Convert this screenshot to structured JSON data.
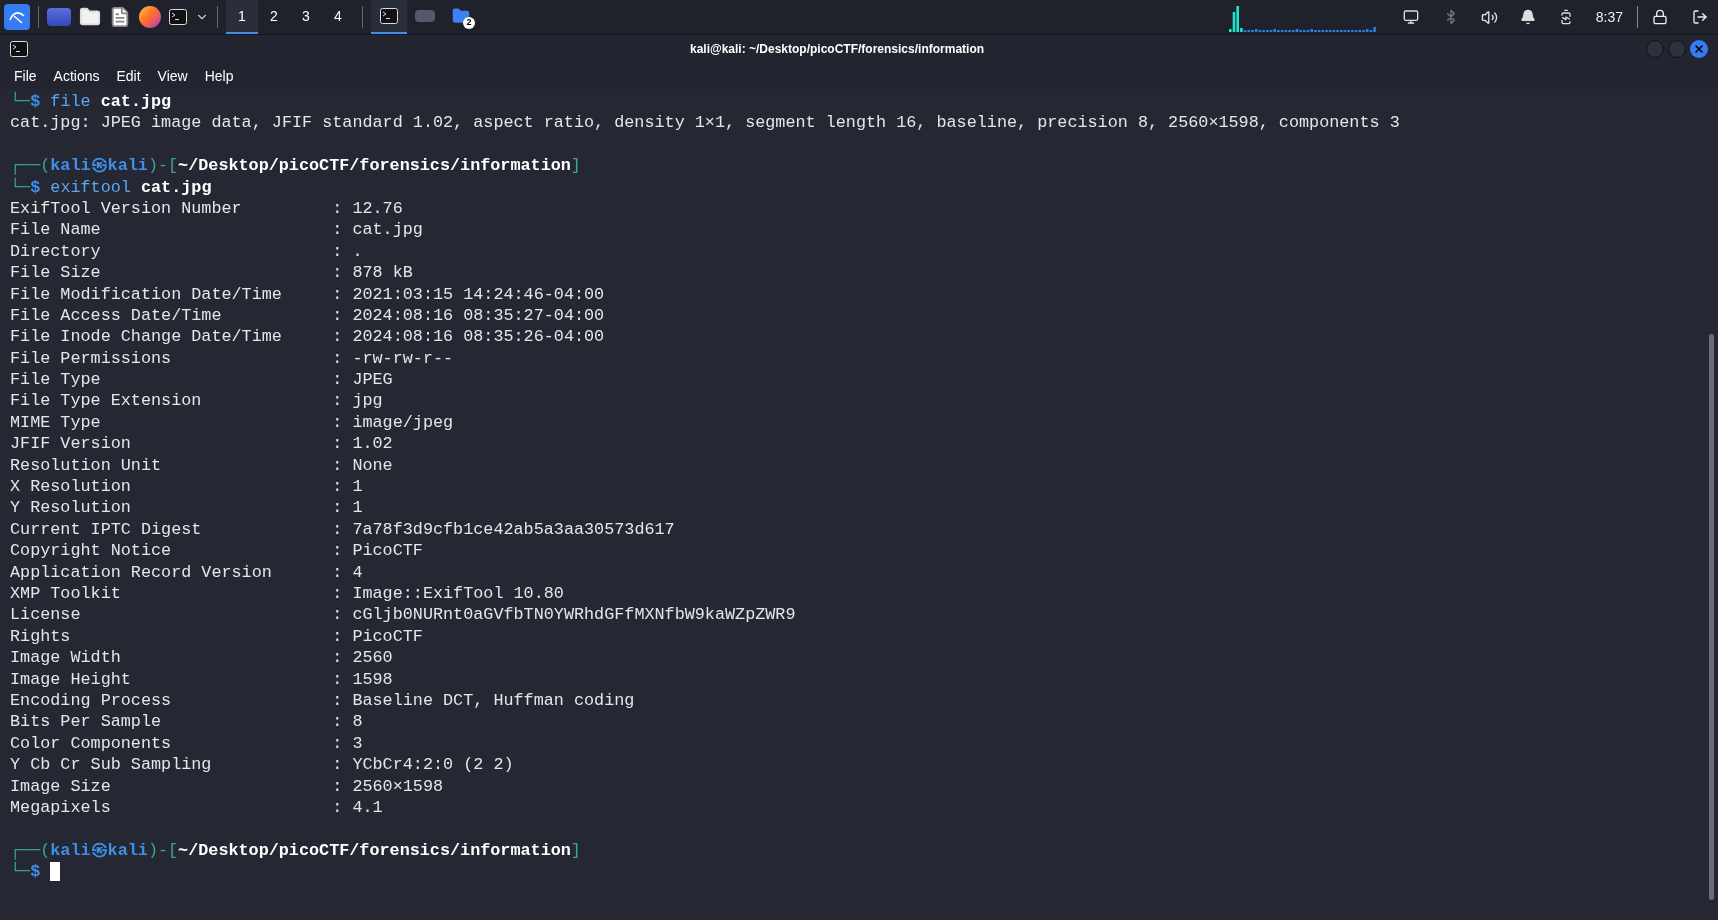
{
  "taskbar": {
    "workspaces": [
      {
        "label": "1",
        "selected": true
      },
      {
        "label": "2",
        "selected": false
      },
      {
        "label": "3",
        "selected": false
      },
      {
        "label": "4",
        "selected": false
      }
    ],
    "tasks": [
      {
        "kind": "terminal",
        "selected": true
      },
      {
        "kind": "image",
        "selected": false
      },
      {
        "kind": "folder",
        "selected": false,
        "badge": "2"
      }
    ],
    "clock": "8:37"
  },
  "window": {
    "title": "kali@kali: ~/Desktop/picoCTF/forensics/information",
    "menu": [
      "File",
      "Actions",
      "Edit",
      "View",
      "Help"
    ]
  },
  "terminal": {
    "field_separator": ":",
    "lines": [
      {
        "kind": "segments",
        "segments": [
          {
            "kind": "frame",
            "text": "└─"
          },
          {
            "kind": "prompt",
            "text": "$ "
          },
          {
            "kind": "command",
            "text": "file "
          },
          {
            "kind": "arg",
            "text": "cat.jpg"
          }
        ]
      },
      {
        "kind": "segments",
        "segments": [
          {
            "kind": "plain",
            "text": "cat.jpg: JPEG image data, JFIF standard 1.02, aspect ratio, density 1×1, segment length 16, baseline, precision 8, 2560×1598, components 3"
          }
        ]
      },
      {
        "kind": "blank"
      },
      {
        "kind": "segments",
        "segments": [
          {
            "kind": "frame",
            "text": "┌──("
          },
          {
            "kind": "user",
            "text": "kali㉿kali"
          },
          {
            "kind": "frame",
            "text": ")-["
          },
          {
            "kind": "path",
            "text": "~/Desktop/picoCTF/forensics/information"
          },
          {
            "kind": "frame",
            "text": "]"
          }
        ]
      },
      {
        "kind": "segments",
        "segments": [
          {
            "kind": "frame",
            "text": "└─"
          },
          {
            "kind": "prompt",
            "text": "$ "
          },
          {
            "kind": "command",
            "text": "exiftool "
          },
          {
            "kind": "arg",
            "text": "cat.jpg"
          }
        ]
      },
      {
        "kind": "field",
        "key": "ExifTool Version Number",
        "value": "12.76"
      },
      {
        "kind": "field",
        "key": "File Name",
        "value": "cat.jpg"
      },
      {
        "kind": "field",
        "key": "Directory",
        "value": "."
      },
      {
        "kind": "field",
        "key": "File Size",
        "value": "878 kB"
      },
      {
        "kind": "field",
        "key": "File Modification Date/Time",
        "value": "2021:03:15 14:24:46-04:00"
      },
      {
        "kind": "field",
        "key": "File Access Date/Time",
        "value": "2024:08:16 08:35:27-04:00"
      },
      {
        "kind": "field",
        "key": "File Inode Change Date/Time",
        "value": "2024:08:16 08:35:26-04:00"
      },
      {
        "kind": "field",
        "key": "File Permissions",
        "value": "-rw-rw-r--"
      },
      {
        "kind": "field",
        "key": "File Type",
        "value": "JPEG"
      },
      {
        "kind": "field",
        "key": "File Type Extension",
        "value": "jpg"
      },
      {
        "kind": "field",
        "key": "MIME Type",
        "value": "image/jpeg"
      },
      {
        "kind": "field",
        "key": "JFIF Version",
        "value": "1.02"
      },
      {
        "kind": "field",
        "key": "Resolution Unit",
        "value": "None"
      },
      {
        "kind": "field",
        "key": "X Resolution",
        "value": "1"
      },
      {
        "kind": "field",
        "key": "Y Resolution",
        "value": "1"
      },
      {
        "kind": "field",
        "key": "Current IPTC Digest",
        "value": "7a78f3d9cfb1ce42ab5a3aa30573d617"
      },
      {
        "kind": "field",
        "key": "Copyright Notice",
        "value": "PicoCTF"
      },
      {
        "kind": "field",
        "key": "Application Record Version",
        "value": "4"
      },
      {
        "kind": "field",
        "key": "XMP Toolkit",
        "value": "Image::ExifTool 10.80"
      },
      {
        "kind": "field",
        "key": "License",
        "value": "cGljb0NURnt0aGVfbTN0YWRhdGFfMXNfbW9kaWZpZWR9"
      },
      {
        "kind": "field",
        "key": "Rights",
        "value": "PicoCTF"
      },
      {
        "kind": "field",
        "key": "Image Width",
        "value": "2560"
      },
      {
        "kind": "field",
        "key": "Image Height",
        "value": "1598"
      },
      {
        "kind": "field",
        "key": "Encoding Process",
        "value": "Baseline DCT, Huffman coding"
      },
      {
        "kind": "field",
        "key": "Bits Per Sample",
        "value": "8"
      },
      {
        "kind": "field",
        "key": "Color Components",
        "value": "3"
      },
      {
        "kind": "field",
        "key": "Y Cb Cr Sub Sampling",
        "value": "YCbCr4:2:0 (2 2)"
      },
      {
        "kind": "field",
        "key": "Image Size",
        "value": "2560×1598"
      },
      {
        "kind": "field",
        "key": "Megapixels",
        "value": "4.1"
      },
      {
        "kind": "blank"
      },
      {
        "kind": "segments",
        "segments": [
          {
            "kind": "frame",
            "text": "┌──("
          },
          {
            "kind": "user",
            "text": "kali㉿kali"
          },
          {
            "kind": "frame",
            "text": ")-["
          },
          {
            "kind": "path",
            "text": "~/Desktop/picoCTF/forensics/information"
          },
          {
            "kind": "frame",
            "text": "]"
          }
        ]
      },
      {
        "kind": "segments",
        "cursor": true,
        "segments": [
          {
            "kind": "frame",
            "text": "└─"
          },
          {
            "kind": "prompt",
            "text": "$ "
          }
        ]
      }
    ]
  }
}
